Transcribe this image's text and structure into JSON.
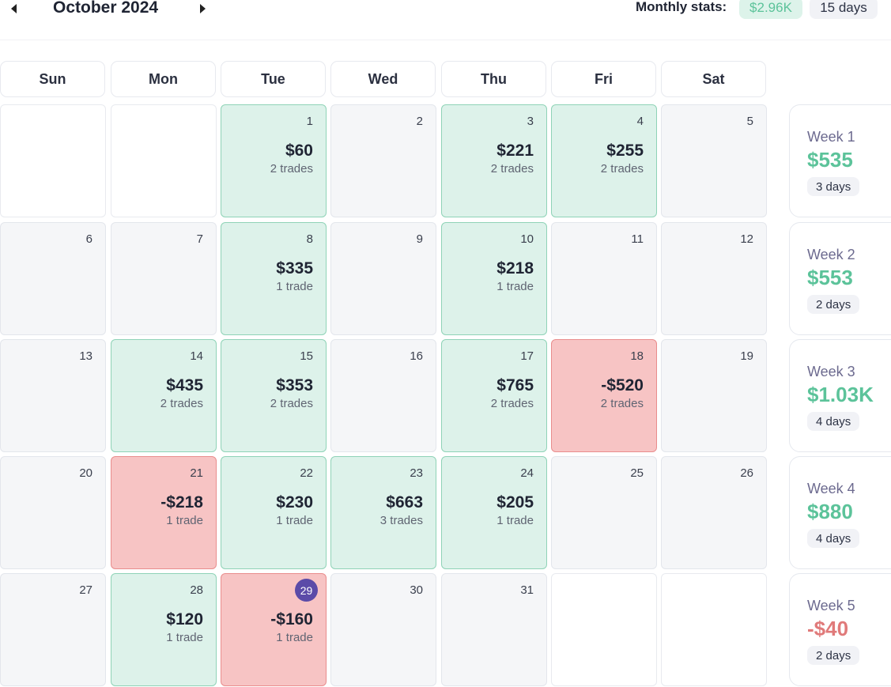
{
  "header": {
    "month": "October 2024",
    "prev_icon": "caret-left-icon",
    "next_icon": "caret-right-icon",
    "stats_label": "Monthly stats:",
    "stats_amount": "$2.96K",
    "stats_days": "15 days"
  },
  "colors": {
    "profit_bg": "#ddf2ea",
    "profit_text": "#5cc39a",
    "loss_bg": "#f7c4c4",
    "loss_text": "#e07a7a",
    "today_badge": "#5b4ba8"
  },
  "weekdays": [
    "Sun",
    "Mon",
    "Tue",
    "Wed",
    "Thu",
    "Fri",
    "Sat"
  ],
  "days": [
    {
      "num": "",
      "status": "blank"
    },
    {
      "num": "",
      "status": "blank"
    },
    {
      "num": "1",
      "status": "profit",
      "amount": "$60",
      "trades": "2 trades"
    },
    {
      "num": "2",
      "status": "none"
    },
    {
      "num": "3",
      "status": "profit",
      "amount": "$221",
      "trades": "2 trades"
    },
    {
      "num": "4",
      "status": "profit",
      "amount": "$255",
      "trades": "2 trades"
    },
    {
      "num": "5",
      "status": "none"
    },
    {
      "num": "6",
      "status": "none"
    },
    {
      "num": "7",
      "status": "none"
    },
    {
      "num": "8",
      "status": "profit",
      "amount": "$335",
      "trades": "1 trade"
    },
    {
      "num": "9",
      "status": "none"
    },
    {
      "num": "10",
      "status": "profit",
      "amount": "$218",
      "trades": "1 trade"
    },
    {
      "num": "11",
      "status": "none"
    },
    {
      "num": "12",
      "status": "none"
    },
    {
      "num": "13",
      "status": "none"
    },
    {
      "num": "14",
      "status": "profit",
      "amount": "$435",
      "trades": "2 trades"
    },
    {
      "num": "15",
      "status": "profit",
      "amount": "$353",
      "trades": "2 trades"
    },
    {
      "num": "16",
      "status": "none"
    },
    {
      "num": "17",
      "status": "profit",
      "amount": "$765",
      "trades": "2 trades"
    },
    {
      "num": "18",
      "status": "loss",
      "amount": "-$520",
      "trades": "2 trades"
    },
    {
      "num": "19",
      "status": "none"
    },
    {
      "num": "20",
      "status": "none"
    },
    {
      "num": "21",
      "status": "loss",
      "amount": "-$218",
      "trades": "1 trade"
    },
    {
      "num": "22",
      "status": "profit",
      "amount": "$230",
      "trades": "1 trade"
    },
    {
      "num": "23",
      "status": "profit",
      "amount": "$663",
      "trades": "3 trades"
    },
    {
      "num": "24",
      "status": "profit",
      "amount": "$205",
      "trades": "1 trade"
    },
    {
      "num": "25",
      "status": "none"
    },
    {
      "num": "26",
      "status": "none"
    },
    {
      "num": "27",
      "status": "none"
    },
    {
      "num": "28",
      "status": "profit",
      "amount": "$120",
      "trades": "1 trade"
    },
    {
      "num": "29",
      "status": "loss",
      "amount": "-$160",
      "trades": "1 trade",
      "today": true
    },
    {
      "num": "30",
      "status": "none"
    },
    {
      "num": "31",
      "status": "none"
    },
    {
      "num": "",
      "status": "blank"
    },
    {
      "num": "",
      "status": "blank"
    }
  ],
  "weeks": [
    {
      "label": "Week 1",
      "amount": "$535",
      "days": "3 days",
      "sign": "pos"
    },
    {
      "label": "Week 2",
      "amount": "$553",
      "days": "2 days",
      "sign": "pos"
    },
    {
      "label": "Week 3",
      "amount": "$1.03K",
      "days": "4 days",
      "sign": "pos"
    },
    {
      "label": "Week 4",
      "amount": "$880",
      "days": "4 days",
      "sign": "pos"
    },
    {
      "label": "Week 5",
      "amount": "-$40",
      "days": "2 days",
      "sign": "neg"
    }
  ]
}
